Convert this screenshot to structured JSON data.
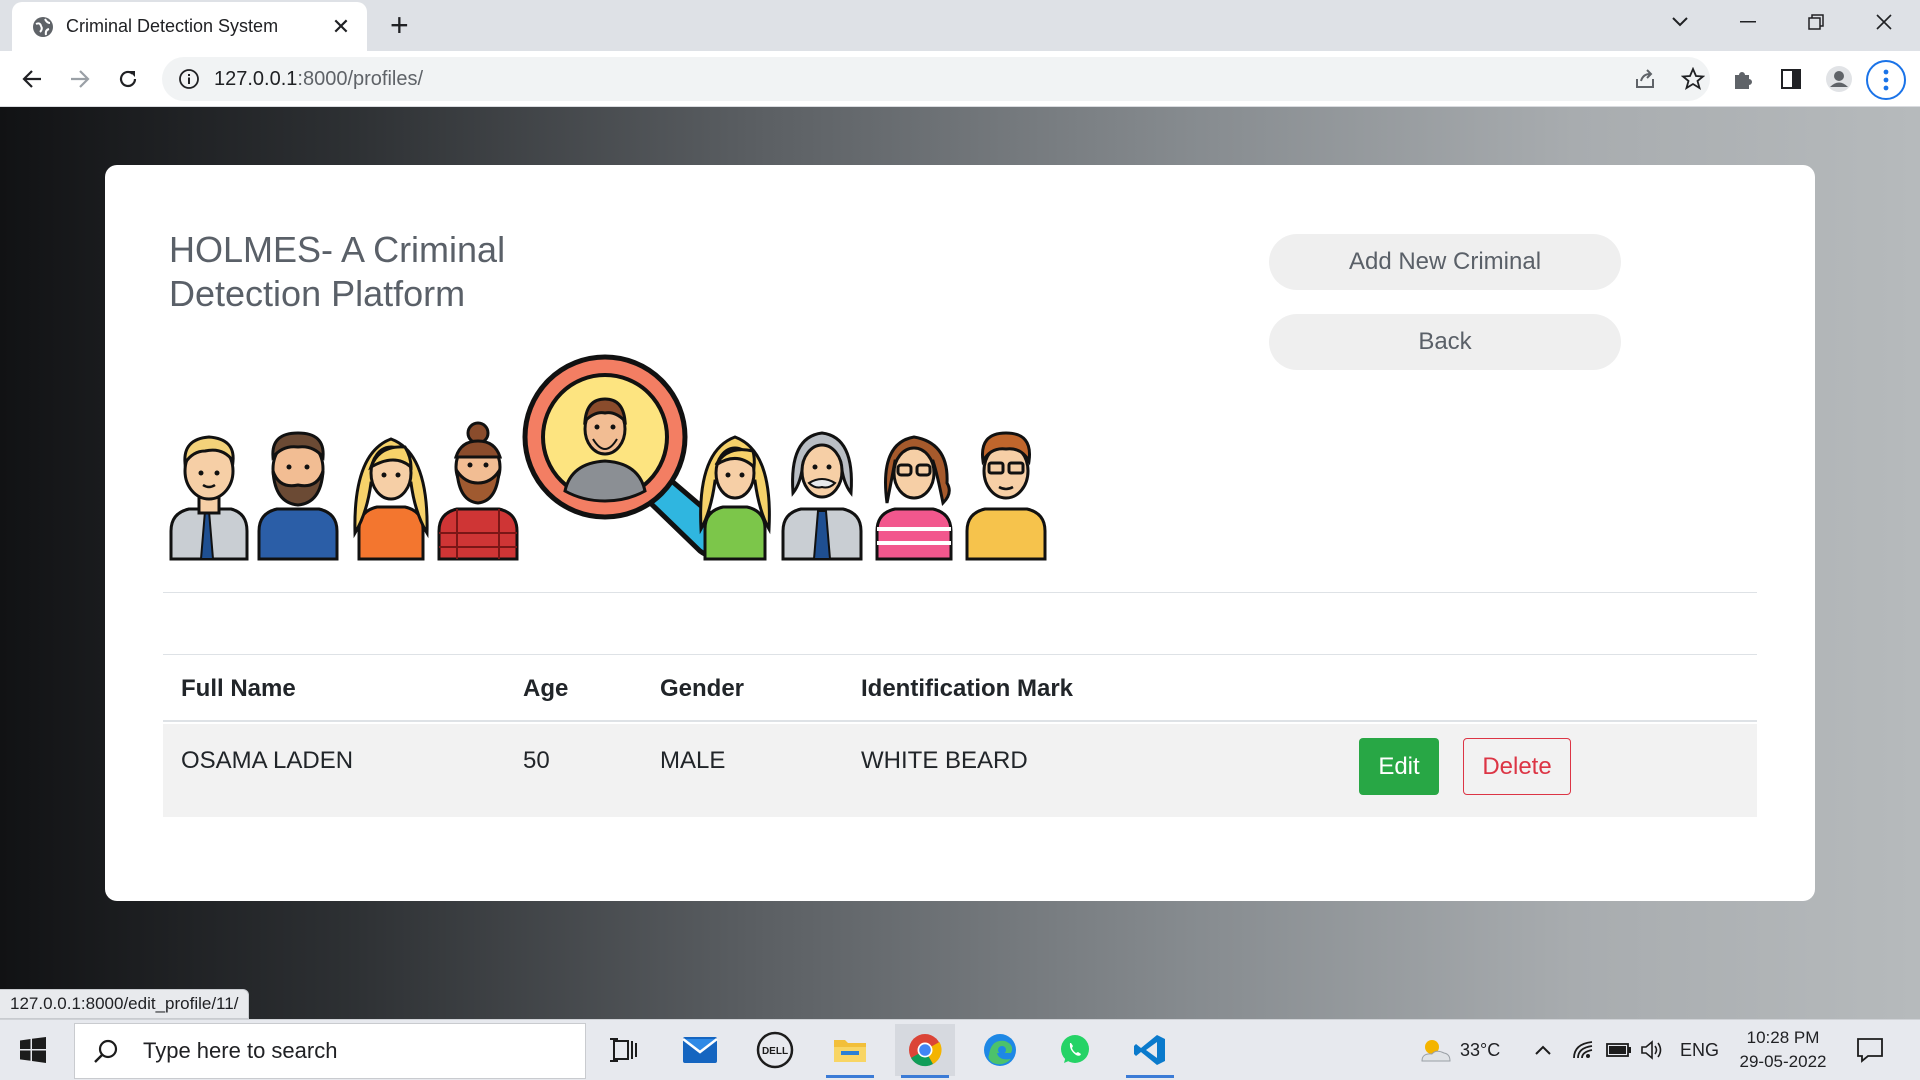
{
  "browser": {
    "tab_title": "Criminal Detection System",
    "tab_close": "✕",
    "new_tab": "+",
    "url_host": "127.0.0.1",
    "url_rest": ":8000/profiles/"
  },
  "page": {
    "heading_line1": "HOLMES- A Criminal",
    "heading_line2": "Detection Platform",
    "add_button": "Add New Criminal",
    "back_button": "Back",
    "table": {
      "headers": [
        "Full Name",
        "Age",
        "Gender",
        "Identification Mark"
      ],
      "rows": [
        {
          "name": "OSAMA LADEN",
          "age": "50",
          "gender": "MALE",
          "mark": "WHITE BEARD",
          "edit": "Edit",
          "delete": "Delete"
        }
      ]
    }
  },
  "status_url": "127.0.0.1:8000/edit_profile/11/",
  "taskbar": {
    "search_placeholder": "Type here to search",
    "temperature": "33°C",
    "language": "ENG",
    "time": "10:28 PM",
    "date": "29-05-2022"
  },
  "colors": {
    "edit_green": "#28a745",
    "delete_red": "#dc3545",
    "heading_gray": "#5a6068"
  }
}
